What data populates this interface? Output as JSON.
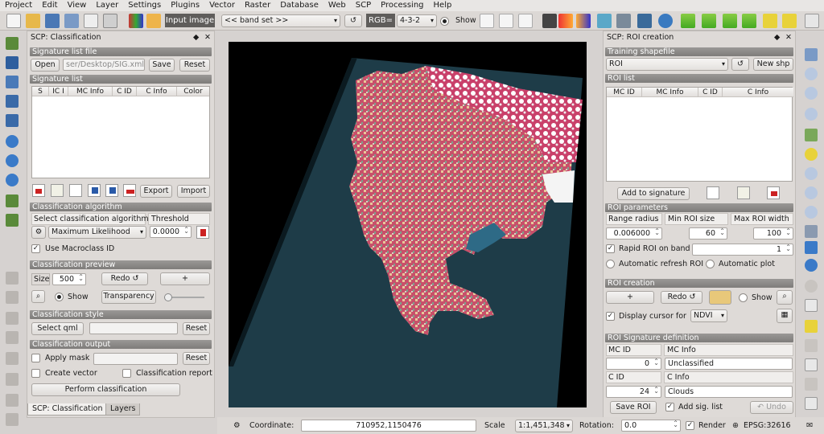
{
  "menu": [
    "Project",
    "Edit",
    "View",
    "Layer",
    "Settings",
    "Plugins",
    "Vector",
    "Raster",
    "Database",
    "Web",
    "SCP",
    "Processing",
    "Help"
  ],
  "toolbar": {
    "input_image_label": "Input image",
    "band_set_value": "<< band set >>",
    "rgb_label": "RGB=",
    "rgb_value": "4-3-2",
    "show_label": "Show"
  },
  "left_panel": {
    "title": "SCP: Classification",
    "signature_file": {
      "header": "Signature list file",
      "open": "Open",
      "path": "ser/Desktop/SIG.xml",
      "save": "Save",
      "reset": "Reset"
    },
    "signature_list": {
      "header": "Signature list",
      "columns": [
        "S",
        "IC I",
        "MC Info",
        "C ID",
        "C Info",
        "Color"
      ],
      "export": "Export",
      "import": "Import"
    },
    "algorithm": {
      "header": "Classification algorithm",
      "select_label": "Select classification algorithm",
      "threshold_label": "Threshold",
      "algorithm_value": "Maximum Likelihood",
      "threshold_value": "0.0000",
      "macroclass_label": "Use Macroclass ID",
      "macroclass_checked": "✓"
    },
    "preview": {
      "header": "Classification preview",
      "size_label": "Size",
      "size_value": "500",
      "redo": "Redo ↺",
      "plus": "+",
      "show_label": "Show",
      "transparency": "Transparency"
    },
    "style": {
      "header": "Classification style",
      "select_qml": "Select qml",
      "reset": "Reset"
    },
    "output": {
      "header": "Classification output",
      "apply_mask": "Apply mask",
      "reset": "Reset",
      "create_vector": "Create vector",
      "classification_report": "Classification report",
      "perform": "Perform classification"
    },
    "tabs": [
      "SCP: Classification",
      "Layers"
    ]
  },
  "right_panel": {
    "title": "SCP: ROI creation",
    "training": {
      "header": "Training shapefile",
      "value": "ROI",
      "new_shp": "New shp"
    },
    "roi_list": {
      "header": "ROI list",
      "columns": [
        "MC ID",
        "MC Info",
        "C ID",
        "C Info"
      ],
      "add_to_signature": "Add to signature"
    },
    "roi_params": {
      "header": "ROI parameters",
      "range_radius_label": "Range radius",
      "min_size_label": "Min ROI size",
      "max_width_label": "Max ROI width",
      "range_radius": "0.006000",
      "min_size": "60",
      "max_width": "100",
      "rapid_roi": "Rapid ROI on band",
      "rapid_band": "1",
      "auto_refresh": "Automatic refresh ROI",
      "auto_plot": "Automatic  plot"
    },
    "roi_creation": {
      "header": "ROI creation",
      "plus": "+",
      "redo": "Redo ↺",
      "show_label": "Show",
      "display_cursor": "Display cursor for",
      "cursor_value": "NDVI"
    },
    "signature_def": {
      "header": "ROI Signature definition",
      "mc_id_label": "MC ID",
      "mc_info_label": "MC Info",
      "mc_id": "0",
      "mc_info": "Unclassified",
      "c_id_label": "C ID",
      "c_info_label": "C Info",
      "c_id": "24",
      "c_info": "Clouds",
      "save_roi": "Save ROI",
      "add_sig_list": "Add sig. list",
      "undo": "↶ Undo"
    }
  },
  "status": {
    "coordinate_label": "Coordinate:",
    "coordinate": "710952,1150476",
    "scale_label": "Scale",
    "scale": "1:1,451,348",
    "rotation_label": "Rotation:",
    "rotation": "0.0",
    "render_label": "Render",
    "crs": "EPSG:32616"
  },
  "colors": {
    "panel_header": "#8a8886",
    "vegetation": "#c23a5c",
    "water": "#1e3c48"
  }
}
